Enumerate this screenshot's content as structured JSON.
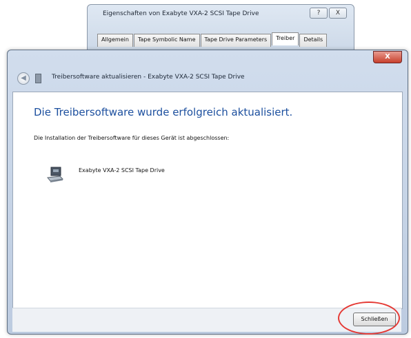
{
  "background_window": {
    "title": "Eigenschaften von Exabyte VXA-2 SCSI Tape Drive",
    "controls": [
      "?",
      "X"
    ],
    "tabs": [
      "Allgemein",
      "Tape Symbolic Name",
      "Tape Drive Parameters",
      "Treiber",
      "Details"
    ],
    "active_tab": "Treiber"
  },
  "dialog": {
    "title": "Treibersoftware aktualisieren - Exabyte VXA-2 SCSI Tape Drive",
    "close_label": "X",
    "heading": "Die Treibersoftware wurde erfolgreich aktualisiert.",
    "description": "Die Installation der Treibersoftware für dieses Gerät ist abgeschlossen:",
    "device_name": "Exabyte VXA-2 SCSI Tape Drive",
    "close_button": "Schließen"
  },
  "colors": {
    "heading": "#1c4f9e",
    "highlight_circle": "#e53a35"
  }
}
